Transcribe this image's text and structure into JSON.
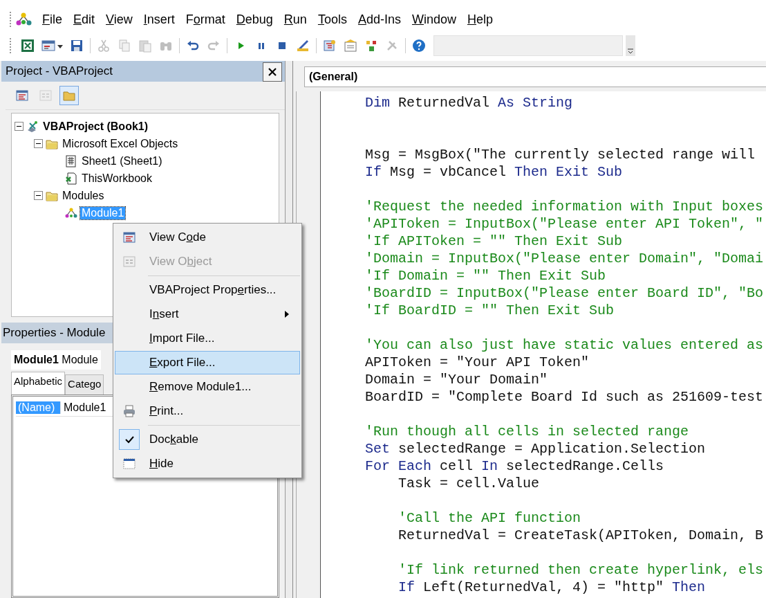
{
  "menu_bar": [
    {
      "key": "F",
      "after": "ile"
    },
    {
      "key": "E",
      "after": "dit"
    },
    {
      "key": "V",
      "after": "iew"
    },
    {
      "key": "I",
      "after": "nsert"
    },
    {
      "before": "F",
      "key": "o",
      "after": "rmat"
    },
    {
      "key": "D",
      "after": "ebug"
    },
    {
      "key": "R",
      "after": "un"
    },
    {
      "key": "T",
      "after": "ools"
    },
    {
      "key": "A",
      "after": "dd-Ins"
    },
    {
      "key": "W",
      "after": "indow"
    },
    {
      "key": "H",
      "after": "elp"
    }
  ],
  "toolbar": [
    {
      "kind": "excel",
      "disabled": false
    },
    {
      "kind": "userform",
      "disabled": false
    },
    {
      "kind": "save",
      "disabled": false
    },
    {
      "kind": "separator"
    },
    {
      "kind": "cut",
      "disabled": true
    },
    {
      "kind": "copy",
      "disabled": true
    },
    {
      "kind": "paste",
      "disabled": true
    },
    {
      "kind": "find",
      "disabled": true
    },
    {
      "kind": "separator"
    },
    {
      "kind": "undo",
      "disabled": false
    },
    {
      "kind": "redo",
      "disabled": true
    },
    {
      "kind": "separator"
    },
    {
      "kind": "run",
      "disabled": false
    },
    {
      "kind": "pause",
      "disabled": false
    },
    {
      "kind": "stop",
      "disabled": false
    },
    {
      "kind": "design",
      "disabled": false
    },
    {
      "kind": "separator"
    },
    {
      "kind": "explorer",
      "disabled": false
    },
    {
      "kind": "properties",
      "disabled": false
    },
    {
      "kind": "browser",
      "disabled": false
    },
    {
      "kind": "toolbox",
      "disabled": true
    },
    {
      "kind": "separator"
    },
    {
      "kind": "help",
      "disabled": false
    }
  ],
  "project_panel": {
    "title": "Project - VBAProject",
    "buttons": [
      {
        "kind": "view-code",
        "selected": false,
        "disabled": false
      },
      {
        "kind": "view-object",
        "selected": false,
        "disabled": true
      },
      {
        "kind": "folders",
        "selected": true,
        "disabled": false
      }
    ],
    "tree": [
      {
        "label": "VBAProject (Book1)",
        "kind": "project",
        "expanded": true,
        "selected": false,
        "children": [
          {
            "label": "Microsoft Excel Objects",
            "kind": "folder",
            "expanded": true,
            "selected": false,
            "children": [
              {
                "label": "Sheet1 (Sheet1)",
                "kind": "sheet",
                "selected": false
              },
              {
                "label": "ThisWorkbook",
                "kind": "workbook",
                "selected": false
              }
            ]
          },
          {
            "label": "Modules",
            "kind": "folder",
            "expanded": true,
            "selected": false,
            "children": [
              {
                "label": "Module1",
                "kind": "module",
                "selected": true
              }
            ]
          }
        ]
      }
    ]
  },
  "properties_panel": {
    "title": "Properties - Module",
    "object_name": "Module1",
    "object_type": "Module",
    "tabs": [
      {
        "label": "Alphabetic",
        "selected": true
      },
      {
        "label": "Catego",
        "selected": false
      }
    ],
    "rows": [
      {
        "name": "(Name)",
        "value": "Module1",
        "selected": true
      }
    ]
  },
  "code_window": {
    "object_combo": "(General)",
    "lines": [
      {
        "kind": "code",
        "tokens": [
          {
            "kind": "keyword",
            "text": "Dim"
          },
          {
            "kind": "plain",
            "text": " ReturnedVal "
          },
          {
            "kind": "keyword",
            "text": "As String"
          }
        ]
      },
      {
        "kind": "blank"
      },
      {
        "kind": "blank"
      },
      {
        "kind": "code",
        "tokens": [
          {
            "kind": "plain",
            "text": "Msg = MsgBox(\"The currently selected range will"
          }
        ]
      },
      {
        "kind": "code",
        "tokens": [
          {
            "kind": "keyword",
            "text": "If"
          },
          {
            "kind": "plain",
            "text": " Msg = vbCancel "
          },
          {
            "kind": "keyword",
            "text": "Then Exit Sub"
          }
        ]
      },
      {
        "kind": "blank"
      },
      {
        "kind": "code",
        "tokens": [
          {
            "kind": "comment",
            "text": "'Request the needed information with Input boxes"
          }
        ]
      },
      {
        "kind": "code",
        "tokens": [
          {
            "kind": "comment",
            "text": "'APIToken = InputBox(\"Please enter API Token\", \""
          }
        ]
      },
      {
        "kind": "code",
        "tokens": [
          {
            "kind": "comment",
            "text": "'If APIToken = \"\" Then Exit Sub"
          }
        ]
      },
      {
        "kind": "code",
        "tokens": [
          {
            "kind": "comment",
            "text": "'Domain = InputBox(\"Please enter Domain\", \"Domai"
          }
        ]
      },
      {
        "kind": "code",
        "tokens": [
          {
            "kind": "comment",
            "text": "'If Domain = \"\" Then Exit Sub"
          }
        ]
      },
      {
        "kind": "code",
        "tokens": [
          {
            "kind": "comment",
            "text": "'BoardID = InputBox(\"Please enter Board ID\", \"Bo"
          }
        ]
      },
      {
        "kind": "code",
        "tokens": [
          {
            "kind": "comment",
            "text": "'If BoardID = \"\" Then Exit Sub"
          }
        ]
      },
      {
        "kind": "blank"
      },
      {
        "kind": "code",
        "tokens": [
          {
            "kind": "comment",
            "text": "'You can also just have static values entered as"
          }
        ]
      },
      {
        "kind": "code",
        "tokens": [
          {
            "kind": "plain",
            "text": "APIToken = \"Your API Token\""
          }
        ]
      },
      {
        "kind": "code",
        "tokens": [
          {
            "kind": "plain",
            "text": "Domain = \"Your Domain\""
          }
        ]
      },
      {
        "kind": "code",
        "tokens": [
          {
            "kind": "plain",
            "text": "BoardID = \"Complete Board Id such as 251609-test"
          }
        ]
      },
      {
        "kind": "blank"
      },
      {
        "kind": "code",
        "tokens": [
          {
            "kind": "comment",
            "text": "'Run though all cells in selected range"
          }
        ]
      },
      {
        "kind": "code",
        "tokens": [
          {
            "kind": "keyword",
            "text": "Set"
          },
          {
            "kind": "plain",
            "text": " selectedRange = Application.Selection"
          }
        ]
      },
      {
        "kind": "code",
        "tokens": [
          {
            "kind": "keyword",
            "text": "For Each"
          },
          {
            "kind": "plain",
            "text": " cell "
          },
          {
            "kind": "keyword",
            "text": "In"
          },
          {
            "kind": "plain",
            "text": " selectedRange.Cells"
          }
        ],
        "children": [
          {
            "kind": "code",
            "tokens": [
              {
                "kind": "plain",
                "text": "Task = cell.Value"
              }
            ]
          },
          {
            "kind": "blank"
          },
          {
            "kind": "code",
            "tokens": [
              {
                "kind": "comment",
                "text": "'Call the API function"
              }
            ]
          },
          {
            "kind": "code",
            "tokens": [
              {
                "kind": "plain",
                "text": "ReturnedVal = CreateTask(APIToken, Domain, B"
              }
            ]
          },
          {
            "kind": "blank"
          },
          {
            "kind": "code",
            "tokens": [
              {
                "kind": "comment",
                "text": "'If link returned then create hyperlink, els"
              }
            ]
          },
          {
            "kind": "code",
            "tokens": [
              {
                "kind": "keyword",
                "text": "If"
              },
              {
                "kind": "plain",
                "text": " Left(ReturnedVal, 4) = \"http\" "
              },
              {
                "kind": "keyword",
                "text": "Then"
              }
            ]
          }
        ]
      }
    ]
  },
  "context_menu": [
    {
      "kind": "view-code",
      "label": {
        "before": "View C",
        "key": "o",
        "after": "de"
      },
      "disabled": false,
      "selected": false
    },
    {
      "kind": "view-object",
      "label": {
        "before": "View O",
        "key": "b",
        "after": "ject"
      },
      "disabled": true,
      "selected": false
    },
    {
      "kind": "separator"
    },
    {
      "kind": "plain",
      "label": {
        "before": "VBAProject Prop",
        "key": "e",
        "after": "rties..."
      },
      "disabled": false,
      "selected": false
    },
    {
      "kind": "plain",
      "label": {
        "before": "I",
        "key": "n",
        "after": "sert"
      },
      "disabled": false,
      "selected": false,
      "submenu": true
    },
    {
      "kind": "plain",
      "label": {
        "key": "I",
        "after": "mport File..."
      },
      "disabled": false,
      "selected": false
    },
    {
      "kind": "plain",
      "label": {
        "key": "E",
        "after": "xport File..."
      },
      "disabled": false,
      "selected": true
    },
    {
      "kind": "plain",
      "label": {
        "key": "R",
        "after": "emove Module1..."
      },
      "disabled": false,
      "selected": false
    },
    {
      "kind": "print",
      "label": {
        "key": "P",
        "after": "rint..."
      },
      "disabled": false,
      "selected": false
    },
    {
      "kind": "separator"
    },
    {
      "kind": "plain",
      "label": {
        "before": "Doc",
        "key": "k",
        "after": "able"
      },
      "disabled": false,
      "selected": false,
      "checked": true
    },
    {
      "kind": "hide",
      "label": {
        "key": "H",
        "after": "ide"
      },
      "disabled": false,
      "selected": false
    }
  ]
}
